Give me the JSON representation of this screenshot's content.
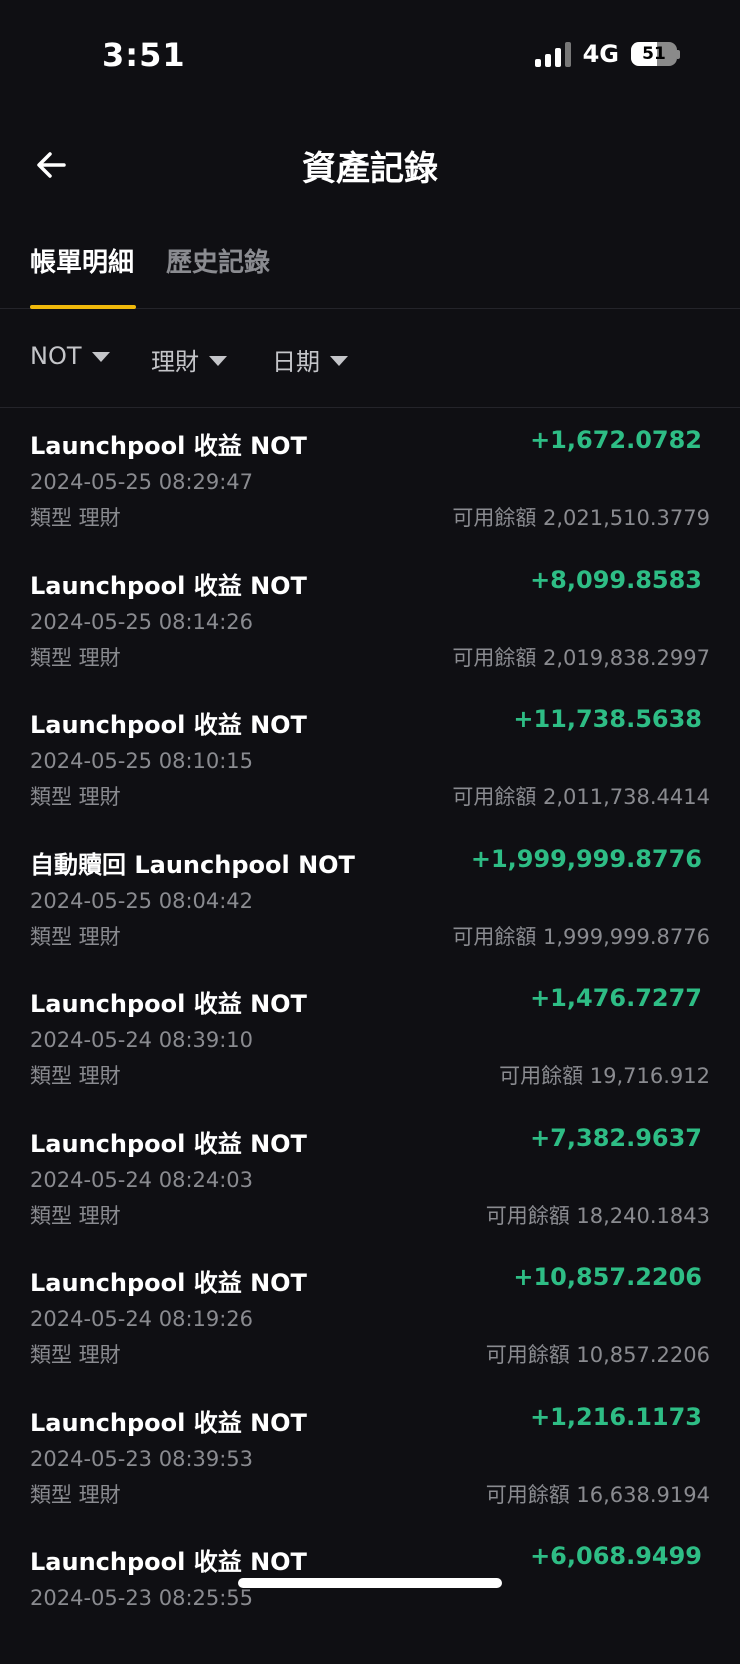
{
  "status_bar": {
    "time": "3:51",
    "network": "4G",
    "battery": "51"
  },
  "header": {
    "title": "資產記錄"
  },
  "tabs": [
    {
      "label": "帳單明細",
      "active": true
    },
    {
      "label": "歷史記錄",
      "active": false
    }
  ],
  "filters": {
    "coin": "NOT",
    "type": "理財",
    "date": "日期"
  },
  "colors": {
    "background": "#0f0f13",
    "accent": "#f0b90b",
    "positive": "#2ebd85"
  },
  "records": [
    {
      "title": "Launchpool 收益 NOT",
      "amount": "+1,672.0782",
      "time": "2024-05-25 08:29:47",
      "type": "類型 理財",
      "balance": "可用餘額 2,021,510.3779"
    },
    {
      "title": "Launchpool 收益 NOT",
      "amount": "+8,099.8583",
      "time": "2024-05-25 08:14:26",
      "type": "類型 理財",
      "balance": "可用餘額 2,019,838.2997"
    },
    {
      "title": "Launchpool 收益 NOT",
      "amount": "+11,738.5638",
      "time": "2024-05-25 08:10:15",
      "type": "類型 理財",
      "balance": "可用餘額 2,011,738.4414"
    },
    {
      "title": "自動贖回 Launchpool NOT",
      "amount": "+1,999,999.8776",
      "time": "2024-05-25 08:04:42",
      "type": "類型 理財",
      "balance": "可用餘額 1,999,999.8776"
    },
    {
      "title": "Launchpool 收益 NOT",
      "amount": "+1,476.7277",
      "time": "2024-05-24 08:39:10",
      "type": "類型 理財",
      "balance": "可用餘額 19,716.912"
    },
    {
      "title": "Launchpool 收益 NOT",
      "amount": "+7,382.9637",
      "time": "2024-05-24 08:24:03",
      "type": "類型 理財",
      "balance": "可用餘額 18,240.1843"
    },
    {
      "title": "Launchpool 收益 NOT",
      "amount": "+10,857.2206",
      "time": "2024-05-24 08:19:26",
      "type": "類型 理財",
      "balance": "可用餘額 10,857.2206"
    },
    {
      "title": "Launchpool 收益 NOT",
      "amount": "+1,216.1173",
      "time": "2024-05-23 08:39:53",
      "type": "類型 理財",
      "balance": "可用餘額 16,638.9194"
    },
    {
      "title": "Launchpool 收益 NOT",
      "amount": "+6,068.9499",
      "time": "2024-05-23 08:25:55",
      "type": "",
      "balance": ""
    }
  ]
}
